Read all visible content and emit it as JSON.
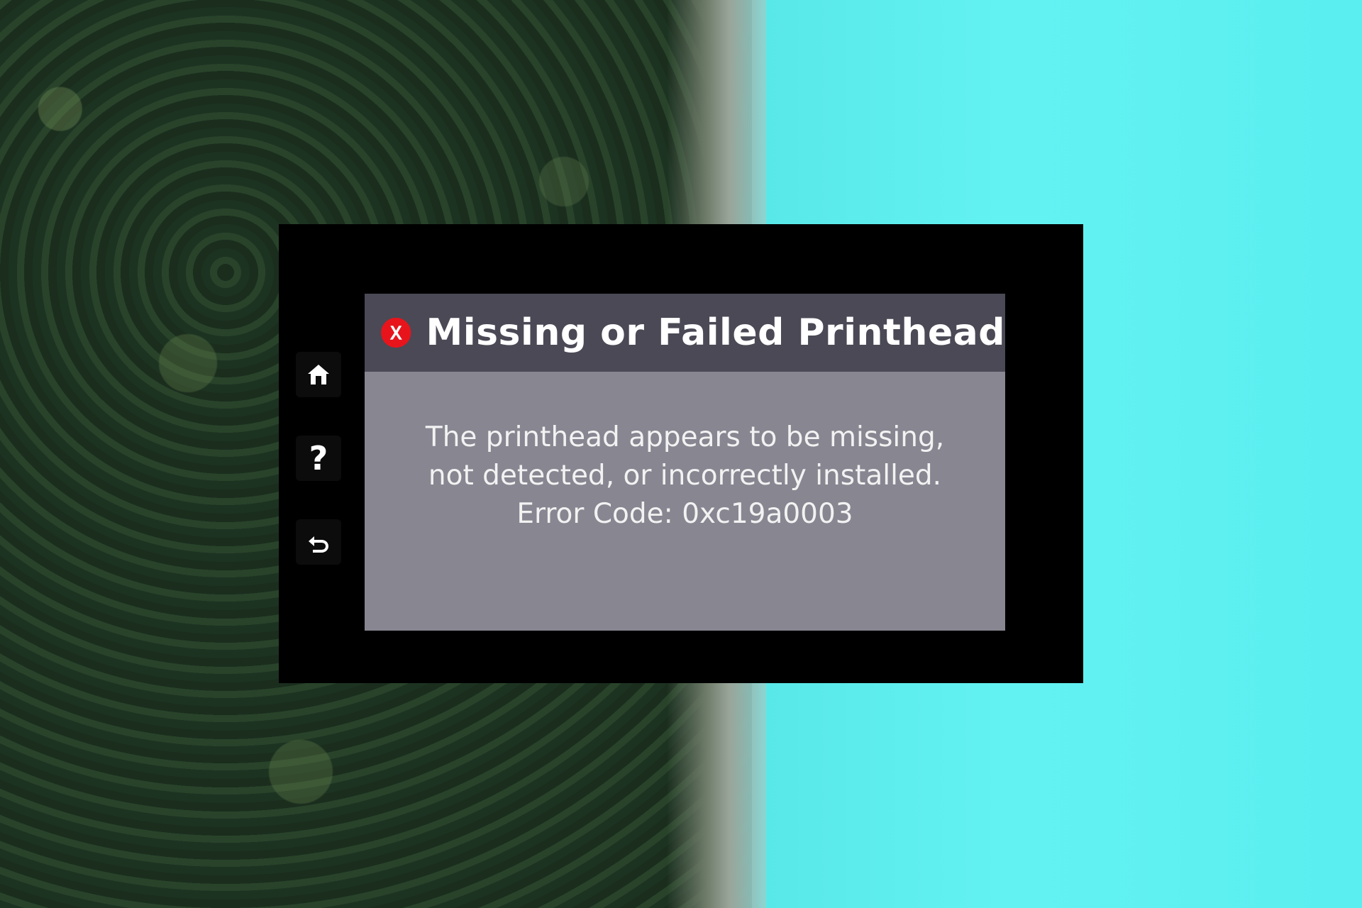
{
  "dialog": {
    "title": "Missing or Failed Printhead",
    "message_line_1": "The printhead appears to be missing,",
    "message_line_2": "not detected, or incorrectly installed.",
    "error_code": "Error Code: 0xc19a0003",
    "error_icon": "error-x-icon"
  },
  "nav": {
    "items": [
      {
        "icon": "home-icon"
      },
      {
        "icon": "help-icon",
        "glyph": "?"
      },
      {
        "icon": "back-icon"
      }
    ]
  },
  "colors": {
    "panel": "#000000",
    "header": "#4a4955",
    "body": "#878691",
    "error_red": "#e8141c"
  }
}
